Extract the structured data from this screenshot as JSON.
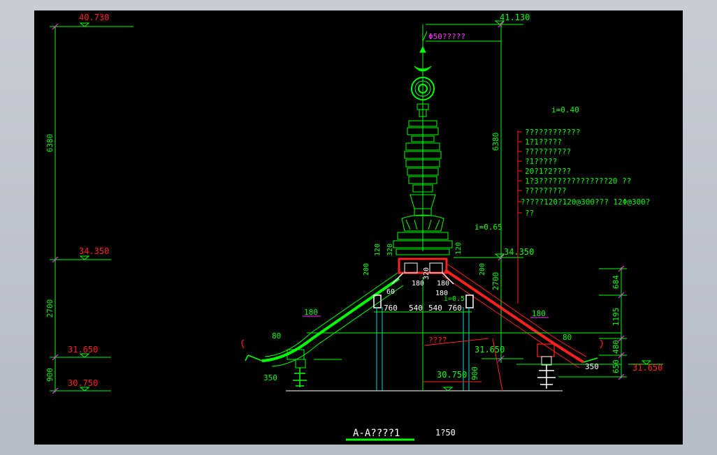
{
  "colors": {
    "background": "#000000",
    "frame": "#c0c4cc",
    "green": "#00ff00",
    "red": "#ff2020",
    "magenta": "#ff33ff",
    "cyan": "#00d8d8",
    "white": "#ffffff"
  },
  "elevations": {
    "top_left": "40.730",
    "top_right": "41.130",
    "mid_left": "34.350",
    "mid_right": "34.350",
    "eave_left": "31.650",
    "eave_center": "31.650",
    "eave_right": "31.650",
    "base_left": "30.750",
    "base_center": "30.750"
  },
  "left_dims": [
    "6380",
    "2700",
    "900"
  ],
  "center_dim_6380": "6380",
  "center_dim_2700": "2700",
  "center_dim_900": "900",
  "right_dims": [
    "684",
    "1195",
    "480",
    "650"
  ],
  "spire_label": "Φ50?????",
  "slope_top": "i=0.40",
  "slope_mid": "i=0.65",
  "slope_low": "i=0.5",
  "notes": [
    "????????????",
    "1?1?????",
    "??????????",
    "?1?????",
    "20?1?2????",
    "1?3???????????????20  ??",
    "?????????",
    "?????120?120@300???     12Φ@300?",
    "??"
  ],
  "center_dims": [
    "760",
    "540",
    "540",
    "760"
  ],
  "small_dims": {
    "d120a": "120",
    "d320a": "320",
    "d200a": "200",
    "d120b": "120",
    "d320b": "320",
    "d200b": "200",
    "d180a": "180",
    "d180b": "180",
    "d180c": "180",
    "d60": "60",
    "d180_left": "180",
    "d80_left": "80",
    "d350_left": "350",
    "d180_right": "180",
    "d80_right": "80",
    "d350_right": "350"
  },
  "gutter_label": "????",
  "title": "A-A????1",
  "scale": "1?50"
}
